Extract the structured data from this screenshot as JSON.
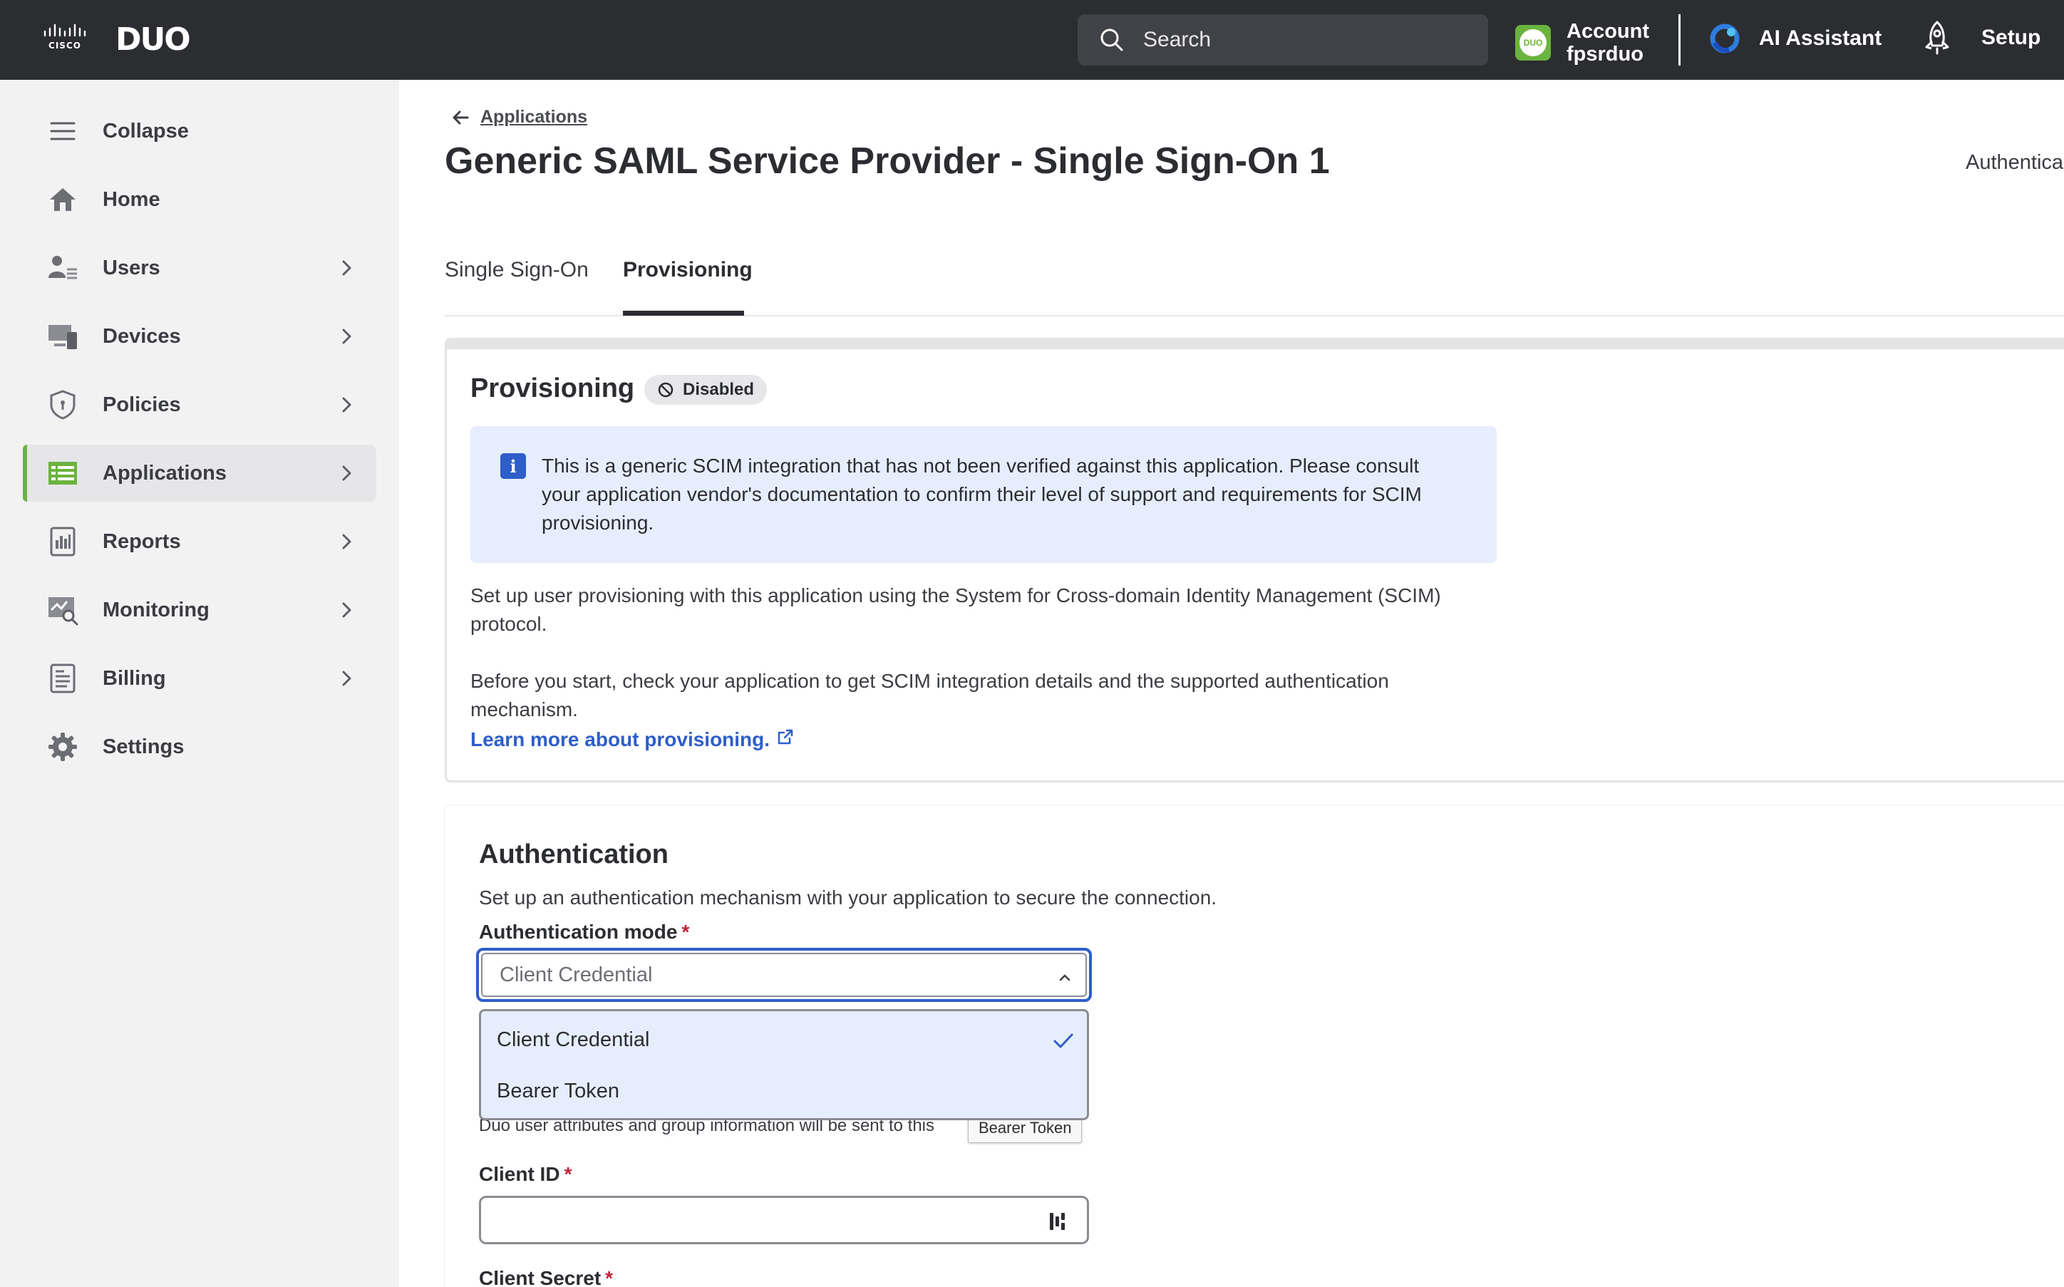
{
  "topbar": {
    "brand": "DUO",
    "search_placeholder": "Search",
    "account_label": "Account",
    "account_name": "fpsrduo",
    "account_badge": "DUO",
    "ai_assistant": "AI Assistant",
    "setup": "Setup"
  },
  "sidebar": {
    "items": [
      {
        "label": "Collapse",
        "icon": "menu-icon"
      },
      {
        "label": "Home",
        "icon": "home-icon"
      },
      {
        "label": "Users",
        "icon": "users-icon"
      },
      {
        "label": "Devices",
        "icon": "devices-icon"
      },
      {
        "label": "Policies",
        "icon": "shield-icon"
      },
      {
        "label": "Applications",
        "icon": "applications-icon",
        "active": true
      },
      {
        "label": "Reports",
        "icon": "reports-icon"
      },
      {
        "label": "Monitoring",
        "icon": "monitoring-icon"
      },
      {
        "label": "Billing",
        "icon": "billing-icon"
      },
      {
        "label": "Settings",
        "icon": "gear-icon"
      }
    ]
  },
  "breadcrumb": "Applications",
  "page_title": "Generic SAML Service Provider - Single Sign-On 1",
  "header_right": "Authentica",
  "tabs": [
    {
      "label": "Single Sign-On"
    },
    {
      "label": "Provisioning",
      "active": true
    }
  ],
  "provisioning": {
    "title": "Provisioning",
    "status": "Disabled",
    "info": "This is a generic SCIM integration that has not been verified against this application. Please consult your application vendor's documentation to confirm their level of support and requirements for SCIM provisioning.",
    "para1": "Set up user provisioning with this application using the System for Cross-domain Identity Management (SCIM) protocol.",
    "para2": "Before you start, check your application to get SCIM integration details and the supported authentication mechanism.",
    "learn_more": "Learn more about provisioning."
  },
  "authentication": {
    "title": "Authentication",
    "description": "Set up an authentication mechanism with your application to secure the connection.",
    "mode_label": "Authentication mode",
    "mode_value": "Client Credential",
    "options": [
      "Client Credential",
      "Bearer Token"
    ],
    "helper": "Duo user attributes and group information will be sent to this",
    "tooltip": "Bearer Token",
    "client_id_label": "Client ID",
    "client_id_value": "",
    "client_secret_label": "Client Secret",
    "required_mark": "*"
  },
  "colors": {
    "topbar": "#2c2d31",
    "accent_green": "#6bb33f",
    "link_blue": "#2d5ec9",
    "info_bg": "#e6eefd",
    "required_red": "#c4213a"
  }
}
